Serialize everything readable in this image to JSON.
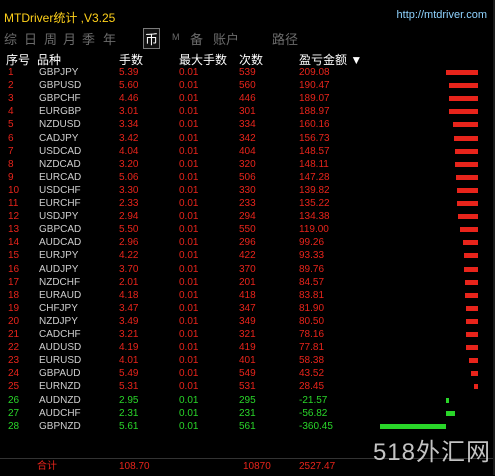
{
  "window": {
    "title": "MTDriver统计 ,V3.25",
    "url": "http://mtdriver.com"
  },
  "tabs": [
    {
      "label": "综"
    },
    {
      "label": "日"
    },
    {
      "label": "周"
    },
    {
      "label": "月"
    },
    {
      "label": "季"
    },
    {
      "label": "年"
    },
    {
      "label": "币",
      "active": true
    },
    {
      "label": "M"
    },
    {
      "label": "备"
    },
    {
      "label": "账户"
    },
    {
      "label": "路径"
    }
  ],
  "columns": {
    "index": "序号",
    "symbol": "品种",
    "lots": "手数",
    "max_lots": "最大手数",
    "count": "次数",
    "profit": "盈亏金额 ▼"
  },
  "rows": [
    {
      "i": "1",
      "sym": "GBPJPY",
      "lots": "5.39",
      "max": "0.01",
      "cnt": "539",
      "pl": "209.08",
      "frac": 1.0
    },
    {
      "i": "2",
      "sym": "GBPUSD",
      "lots": "5.60",
      "max": "0.01",
      "cnt": "560",
      "pl": "190.47",
      "frac": 0.91
    },
    {
      "i": "3",
      "sym": "GBPCHF",
      "lots": "4.46",
      "max": "0.01",
      "cnt": "446",
      "pl": "189.07",
      "frac": 0.9
    },
    {
      "i": "4",
      "sym": "EURGBP",
      "lots": "3.01",
      "max": "0.01",
      "cnt": "301",
      "pl": "188.97",
      "frac": 0.9
    },
    {
      "i": "5",
      "sym": "NZDUSD",
      "lots": "3.34",
      "max": "0.01",
      "cnt": "334",
      "pl": "160.16",
      "frac": 0.77
    },
    {
      "i": "6",
      "sym": "CADJPY",
      "lots": "3.42",
      "max": "0.01",
      "cnt": "342",
      "pl": "156.73",
      "frac": 0.75
    },
    {
      "i": "7",
      "sym": "USDCAD",
      "lots": "4.04",
      "max": "0.01",
      "cnt": "404",
      "pl": "148.57",
      "frac": 0.71
    },
    {
      "i": "8",
      "sym": "NZDCAD",
      "lots": "3.20",
      "max": "0.01",
      "cnt": "320",
      "pl": "148.11",
      "frac": 0.71
    },
    {
      "i": "9",
      "sym": "EURCAD",
      "lots": "5.06",
      "max": "0.01",
      "cnt": "506",
      "pl": "147.28",
      "frac": 0.7
    },
    {
      "i": "10",
      "sym": "USDCHF",
      "lots": "3.30",
      "max": "0.01",
      "cnt": "330",
      "pl": "139.82",
      "frac": 0.67
    },
    {
      "i": "11",
      "sym": "EURCHF",
      "lots": "2.33",
      "max": "0.01",
      "cnt": "233",
      "pl": "135.22",
      "frac": 0.65
    },
    {
      "i": "12",
      "sym": "USDJPY",
      "lots": "2.94",
      "max": "0.01",
      "cnt": "294",
      "pl": "134.38",
      "frac": 0.64
    },
    {
      "i": "13",
      "sym": "GBPCAD",
      "lots": "5.50",
      "max": "0.01",
      "cnt": "550",
      "pl": "119.00",
      "frac": 0.57
    },
    {
      "i": "14",
      "sym": "AUDCAD",
      "lots": "2.96",
      "max": "0.01",
      "cnt": "296",
      "pl": "99.26",
      "frac": 0.47
    },
    {
      "i": "15",
      "sym": "EURJPY",
      "lots": "4.22",
      "max": "0.01",
      "cnt": "422",
      "pl": "93.33",
      "frac": 0.45
    },
    {
      "i": "16",
      "sym": "AUDJPY",
      "lots": "3.70",
      "max": "0.01",
      "cnt": "370",
      "pl": "89.76",
      "frac": 0.43
    },
    {
      "i": "17",
      "sym": "NZDCHF",
      "lots": "2.01",
      "max": "0.01",
      "cnt": "201",
      "pl": "84.57",
      "frac": 0.4
    },
    {
      "i": "18",
      "sym": "EURAUD",
      "lots": "4.18",
      "max": "0.01",
      "cnt": "418",
      "pl": "83.81",
      "frac": 0.4
    },
    {
      "i": "19",
      "sym": "CHFJPY",
      "lots": "3.47",
      "max": "0.01",
      "cnt": "347",
      "pl": "81.90",
      "frac": 0.39
    },
    {
      "i": "20",
      "sym": "NZDJPY",
      "lots": "3.49",
      "max": "0.01",
      "cnt": "349",
      "pl": "80.50",
      "frac": 0.39
    },
    {
      "i": "21",
      "sym": "CADCHF",
      "lots": "3.21",
      "max": "0.01",
      "cnt": "321",
      "pl": "78.16",
      "frac": 0.37
    },
    {
      "i": "22",
      "sym": "AUDUSD",
      "lots": "4.19",
      "max": "0.01",
      "cnt": "419",
      "pl": "77.81",
      "frac": 0.37
    },
    {
      "i": "23",
      "sym": "EURUSD",
      "lots": "4.01",
      "max": "0.01",
      "cnt": "401",
      "pl": "58.38",
      "frac": 0.28
    },
    {
      "i": "24",
      "sym": "GBPAUD",
      "lots": "5.49",
      "max": "0.01",
      "cnt": "549",
      "pl": "43.52",
      "frac": 0.21
    },
    {
      "i": "25",
      "sym": "EURNZD",
      "lots": "5.31",
      "max": "0.01",
      "cnt": "531",
      "pl": "28.45",
      "frac": 0.14
    },
    {
      "i": "26",
      "sym": "AUDNZD",
      "lots": "2.95",
      "max": "0.01",
      "cnt": "295",
      "pl": "-21.57",
      "frac": 0.1
    },
    {
      "i": "27",
      "sym": "AUDCHF",
      "lots": "2.31",
      "max": "0.01",
      "cnt": "231",
      "pl": "-56.82",
      "frac": 0.27
    },
    {
      "i": "28",
      "sym": "GBPNZD",
      "lots": "5.61",
      "max": "0.01",
      "cnt": "561",
      "pl": "-360.45",
      "frac": 1.0
    }
  ],
  "totals": {
    "label": "合计",
    "lots": "108.70",
    "count": "10870",
    "profit": "2527.47"
  },
  "watermark": "518外汇网",
  "colors": {
    "positive": "#e8241b",
    "negative": "#29d629",
    "title": "#ffd11a"
  }
}
